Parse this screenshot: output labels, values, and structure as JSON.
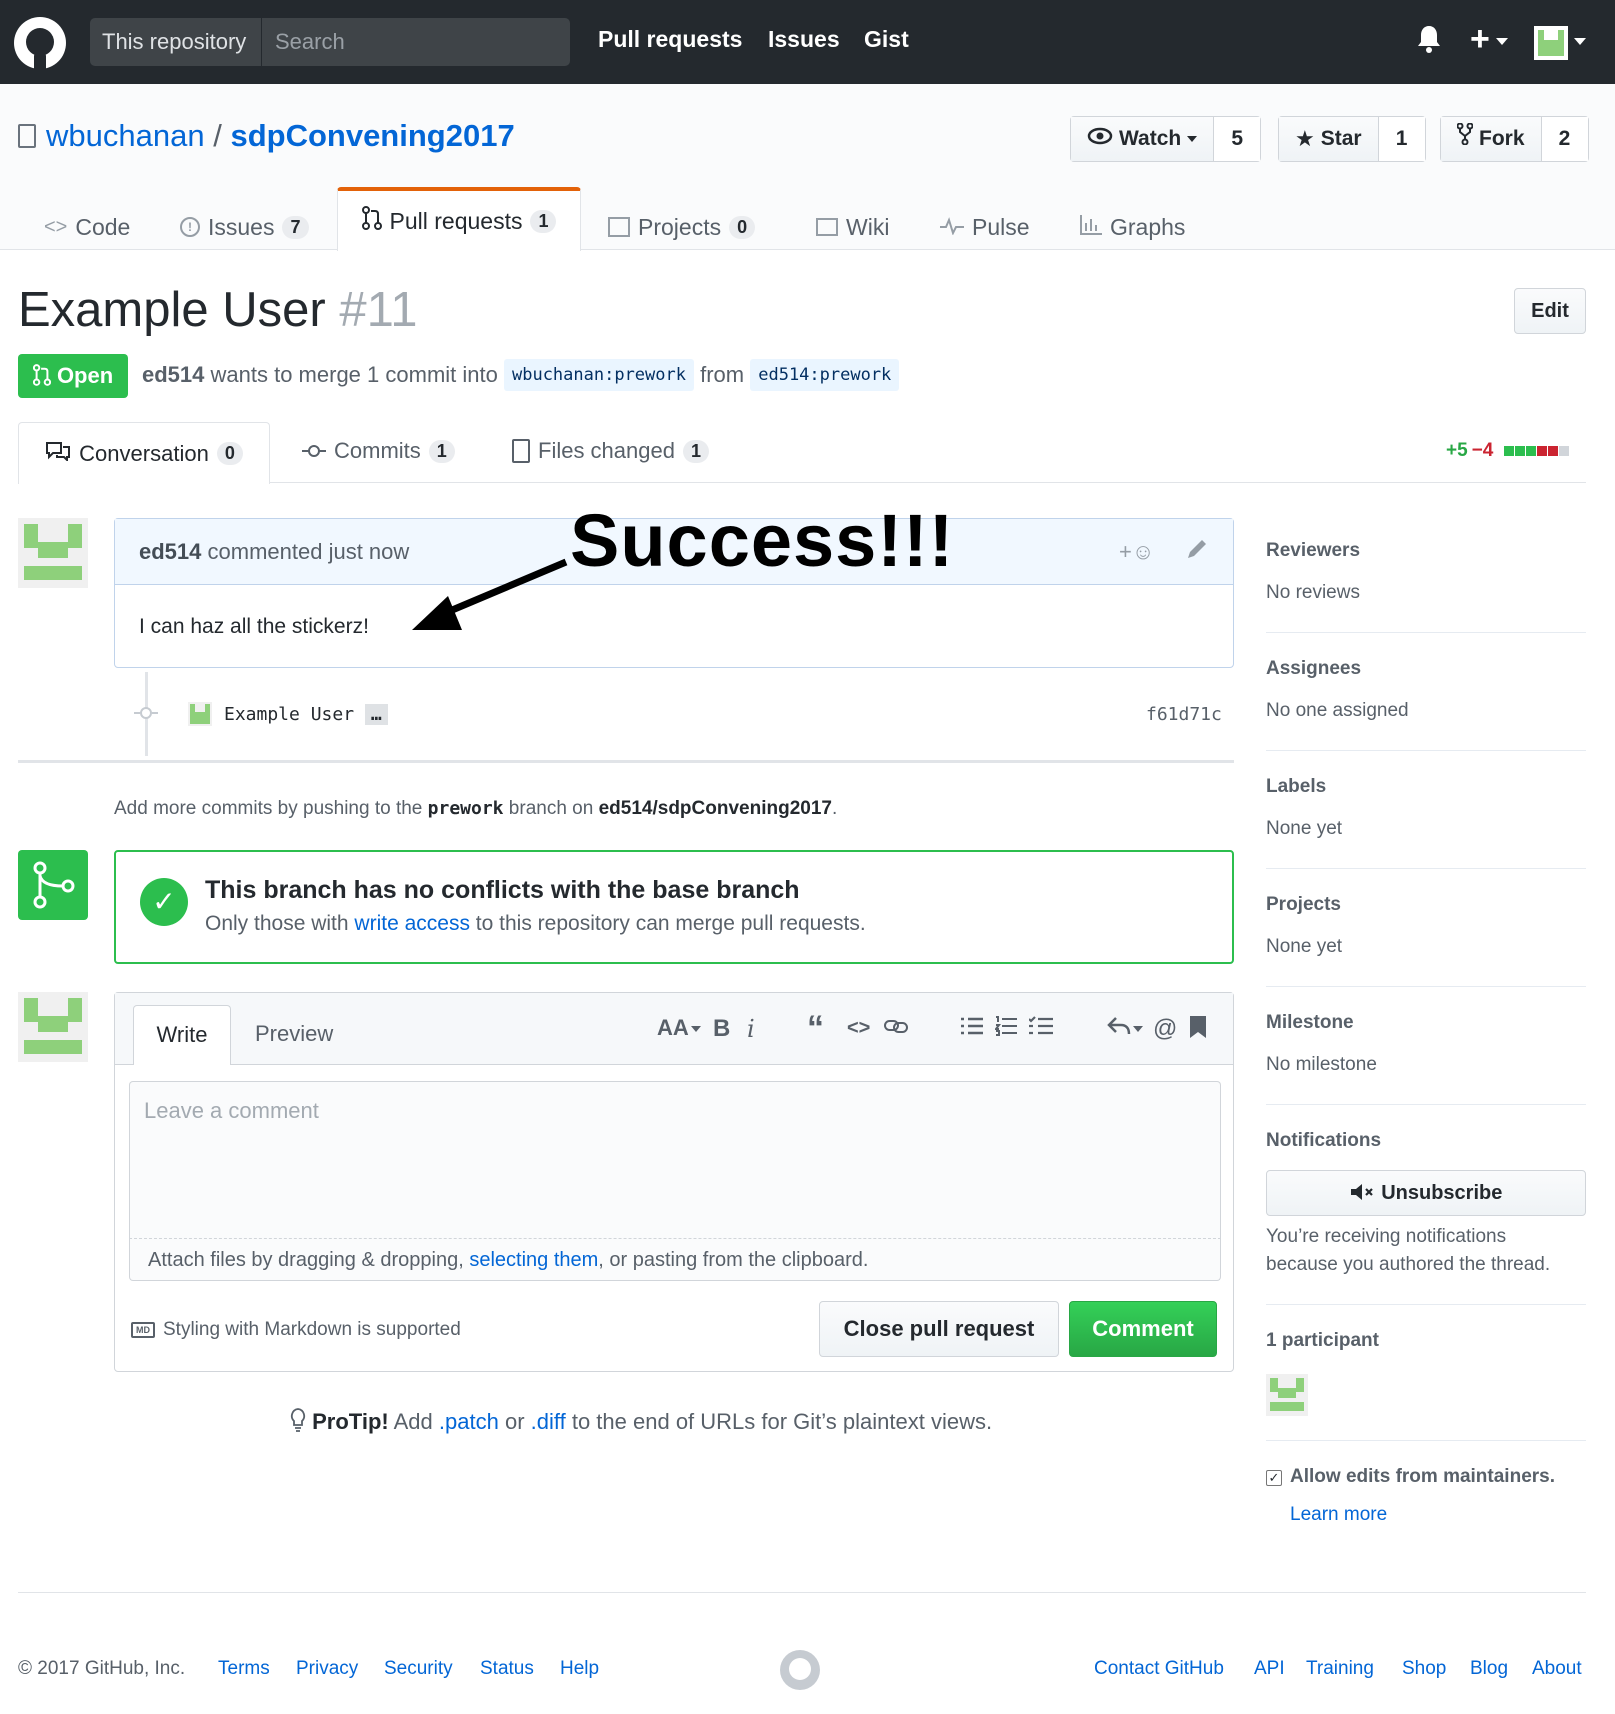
{
  "header": {
    "search_scope": "This repository",
    "search_placeholder": "Search",
    "nav": [
      "Pull requests",
      "Issues",
      "Gist"
    ],
    "plus_label": "+"
  },
  "repo": {
    "owner": "wbuchanan",
    "separator": "/",
    "name": "sdpConvening2017",
    "watch_label": "Watch",
    "watch_count": "5",
    "star_label": "Star",
    "star_count": "1",
    "fork_label": "Fork",
    "fork_count": "2",
    "tabs": [
      {
        "label": "Code",
        "count": ""
      },
      {
        "label": "Issues",
        "count": "7"
      },
      {
        "label": "Pull requests",
        "count": "1"
      },
      {
        "label": "Projects",
        "count": "0"
      },
      {
        "label": "Wiki",
        "count": ""
      },
      {
        "label": "Pulse",
        "count": ""
      },
      {
        "label": "Graphs",
        "count": ""
      }
    ]
  },
  "pr": {
    "title": "Example User",
    "number": "#11",
    "edit_label": "Edit",
    "state": "Open",
    "author": "ed514",
    "merge_text": "wants to merge 1 commit into",
    "base_branch": "wbuchanan:prework",
    "from_text": "from",
    "head_branch": "ed514:prework",
    "subtabs": [
      {
        "label": "Conversation",
        "count": "0"
      },
      {
        "label": "Commits",
        "count": "1"
      },
      {
        "label": "Files changed",
        "count": "1"
      }
    ],
    "additions": "+5",
    "deletions": "−4"
  },
  "comment": {
    "author": "ed514",
    "meta": "commented just now",
    "body": "I can haz all the stickerz!",
    "annotation": "Success!!!"
  },
  "commit": {
    "author": "Example User",
    "ellipsis": "…",
    "sha": "f61d71c"
  },
  "push_info": {
    "prefix": "Add more commits by pushing to the",
    "branch": "prework",
    "middle": "branch on",
    "repo": "ed514/sdpConvening2017",
    "suffix": "."
  },
  "merge": {
    "title": "This branch has no conflicts with the base branch",
    "sub_prefix": "Only those with",
    "sub_link": "write access",
    "sub_suffix": "to this repository can merge pull requests."
  },
  "editor": {
    "tab_write": "Write",
    "tab_preview": "Preview",
    "placeholder": "Leave a comment",
    "attach_prefix": "Attach files by dragging & dropping,",
    "attach_link": "selecting them",
    "attach_suffix": ", or pasting from the clipboard.",
    "markdown_icon": "MD",
    "markdown_note": "Styling with Markdown is supported",
    "close_label": "Close pull request",
    "comment_label": "Comment",
    "toolbar": {
      "heading": "AA",
      "bold": "B",
      "italic": "i",
      "quote": "“",
      "code": "<>",
      "mention": "@"
    }
  },
  "protip": {
    "label": "ProTip!",
    "prefix": "Add",
    "link1": ".patch",
    "or": "or",
    "link2": ".diff",
    "suffix": "to the end of URLs for Git’s plaintext views."
  },
  "sidebar": {
    "reviewers_h": "Reviewers",
    "reviewers_v": "No reviews",
    "assignees_h": "Assignees",
    "assignees_v": "No one assigned",
    "labels_h": "Labels",
    "labels_v": "None yet",
    "projects_h": "Projects",
    "projects_v": "None yet",
    "milestone_h": "Milestone",
    "milestone_v": "No milestone",
    "notifications_h": "Notifications",
    "unsubscribe": "Unsubscribe",
    "notif_line1": "You’re receiving notifications",
    "notif_line2": "because you authored the thread.",
    "participants_h": "1 participant",
    "allow_edits": "Allow edits from maintainers.",
    "learn_more": "Learn more"
  },
  "footer": {
    "copyright": "© 2017 GitHub, Inc.",
    "left_links": [
      "Terms",
      "Privacy",
      "Security",
      "Status",
      "Help"
    ],
    "right_links": [
      "Contact GitHub",
      "API",
      "Training",
      "Shop",
      "Blog",
      "About"
    ]
  },
  "colors": {
    "green": "#2cbe4e",
    "red": "#cb2431",
    "link": "#0366d6",
    "header_bg": "#24292e"
  }
}
